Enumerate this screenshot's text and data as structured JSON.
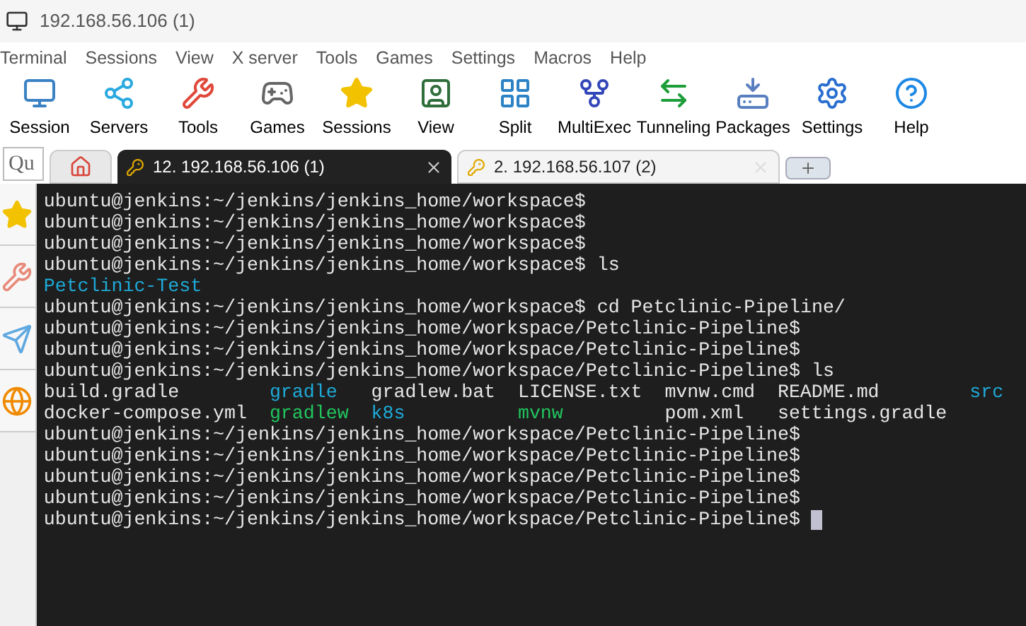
{
  "window": {
    "title": "192.168.56.106 (1)"
  },
  "menu": [
    "Terminal",
    "Sessions",
    "View",
    "X server",
    "Tools",
    "Games",
    "Settings",
    "Macros",
    "Help"
  ],
  "toolbar": [
    {
      "label": "Session",
      "kind": "session"
    },
    {
      "label": "Servers",
      "kind": "servers"
    },
    {
      "label": "Tools",
      "kind": "tools"
    },
    {
      "label": "Games",
      "kind": "games"
    },
    {
      "label": "Sessions",
      "kind": "sessions"
    },
    {
      "label": "View",
      "kind": "view"
    },
    {
      "label": "Split",
      "kind": "split"
    },
    {
      "label": "MultiExec",
      "kind": "multiexec"
    },
    {
      "label": "Tunneling",
      "kind": "tunneling"
    },
    {
      "label": "Packages",
      "kind": "packages"
    },
    {
      "label": "Settings",
      "kind": "settings"
    },
    {
      "label": "Help",
      "kind": "help"
    }
  ],
  "quick_connect": {
    "placeholder": "Qu"
  },
  "tabs": [
    {
      "label": "12. 192.168.56.106 (1)",
      "selected": true
    },
    {
      "label": "2. 192.168.56.107 (2)",
      "selected": false
    }
  ],
  "sidebar": [
    {
      "kind": "star"
    },
    {
      "kind": "tools"
    },
    {
      "kind": "send"
    },
    {
      "kind": "globe"
    }
  ],
  "terminal": {
    "lines": [
      {
        "kind": "prompt",
        "text": "ubuntu@jenkins:~/jenkins/jenkins_home/workspace$"
      },
      {
        "kind": "prompt",
        "text": "ubuntu@jenkins:~/jenkins/jenkins_home/workspace$"
      },
      {
        "kind": "prompt",
        "text": "ubuntu@jenkins:~/jenkins/jenkins_home/workspace$"
      },
      {
        "kind": "prompt",
        "text": "ubuntu@jenkins:~/jenkins/jenkins_home/workspace$ ls"
      },
      {
        "kind": "listing",
        "entries": [
          {
            "name": "Petclinic-Test",
            "color": "#1eaad8"
          }
        ]
      },
      {
        "kind": "prompt",
        "text": "ubuntu@jenkins:~/jenkins/jenkins_home/workspace$ cd Petclinic-Pipeline/"
      },
      {
        "kind": "prompt",
        "text": "ubuntu@jenkins:~/jenkins/jenkins_home/workspace/Petclinic-Pipeline$"
      },
      {
        "kind": "prompt",
        "text": "ubuntu@jenkins:~/jenkins/jenkins_home/workspace/Petclinic-Pipeline$"
      },
      {
        "kind": "prompt",
        "text": "ubuntu@jenkins:~/jenkins/jenkins_home/workspace/Petclinic-Pipeline$ ls"
      },
      {
        "kind": "listing",
        "entries": [
          {
            "name": "build.gradle",
            "color": "#e6e6e6"
          },
          {
            "name": "gradle",
            "color": "#1eaad8"
          },
          {
            "name": "gradlew.bat",
            "color": "#e6e6e6"
          },
          {
            "name": "LICENSE.txt",
            "color": "#e6e6e6"
          },
          {
            "name": "mvnw.cmd",
            "color": "#e6e6e6"
          },
          {
            "name": "README.md",
            "color": "#e6e6e6"
          },
          {
            "name": "src",
            "color": "#1eaad8"
          }
        ]
      },
      {
        "kind": "listing",
        "entries": [
          {
            "name": "docker-compose.yml",
            "color": "#e6e6e6"
          },
          {
            "name": "gradlew",
            "color": "#22c55e"
          },
          {
            "name": "k8s",
            "color": "#1eaad8"
          },
          {
            "name": "mvnw",
            "color": "#22c55e"
          },
          {
            "name": "pom.xml",
            "color": "#e6e6e6"
          },
          {
            "name": "settings.gradle",
            "color": "#e6e6e6"
          }
        ]
      },
      {
        "kind": "prompt",
        "text": "ubuntu@jenkins:~/jenkins/jenkins_home/workspace/Petclinic-Pipeline$"
      },
      {
        "kind": "prompt",
        "text": "ubuntu@jenkins:~/jenkins/jenkins_home/workspace/Petclinic-Pipeline$"
      },
      {
        "kind": "prompt",
        "text": "ubuntu@jenkins:~/jenkins/jenkins_home/workspace/Petclinic-Pipeline$"
      },
      {
        "kind": "prompt",
        "text": "ubuntu@jenkins:~/jenkins/jenkins_home/workspace/Petclinic-Pipeline$"
      },
      {
        "kind": "prompt",
        "text": "ubuntu@jenkins:~/jenkins/jenkins_home/workspace/Petclinic-Pipeline$",
        "cursor": true
      }
    ]
  }
}
